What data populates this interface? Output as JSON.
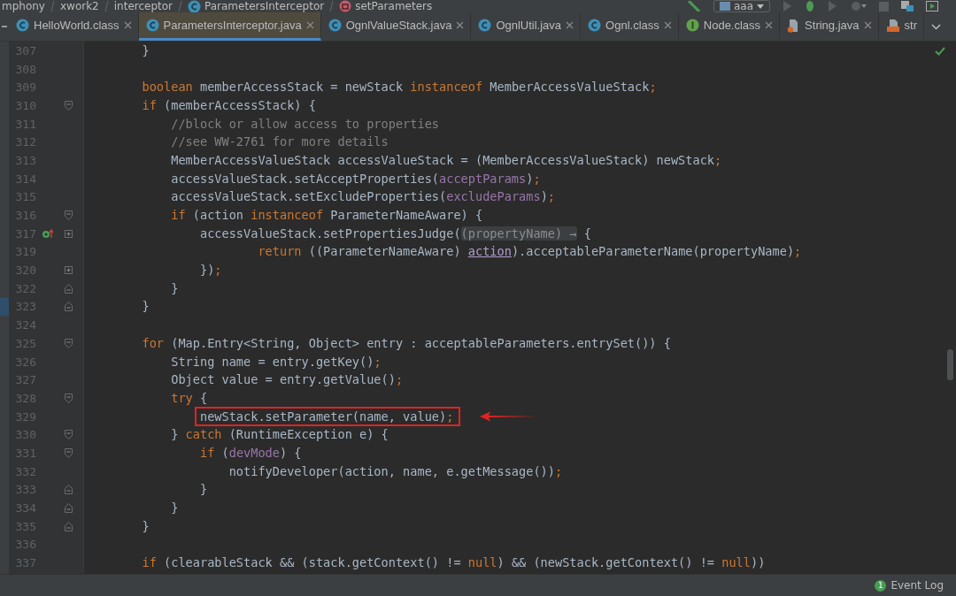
{
  "breadcrumbs": [
    {
      "label": "mphony"
    },
    {
      "label": "xwork2"
    },
    {
      "label": "interceptor"
    },
    {
      "label": "ParametersInterceptor",
      "kind": "class"
    },
    {
      "label": "setParameters",
      "kind": "method"
    }
  ],
  "run_config": {
    "label": "aaa"
  },
  "tabs": [
    {
      "label": "HelloWorld.class",
      "kind": "class",
      "selected": false,
      "closable": true
    },
    {
      "label": "ParametersInterceptor.java",
      "kind": "class",
      "selected": true,
      "closable": true
    },
    {
      "label": "OgnlValueStack.java",
      "kind": "class",
      "selected": false,
      "closable": true
    },
    {
      "label": "OgnlUtil.java",
      "kind": "class",
      "selected": false,
      "closable": true
    },
    {
      "label": "Ognl.class",
      "kind": "class",
      "selected": false,
      "closable": true
    },
    {
      "label": "Node.class",
      "kind": "interface",
      "selected": false,
      "closable": true
    },
    {
      "label": "String.java",
      "kind": "source",
      "selected": false,
      "closable": true
    },
    {
      "label": "str",
      "kind": "html",
      "selected": false,
      "closable": false
    }
  ],
  "editor": {
    "lines": [
      {
        "number": "307",
        "segments": [
          {
            "kind": "plain",
            "text": "        }"
          }
        ]
      },
      {
        "number": "308"
      },
      {
        "number": "309",
        "segments": [
          {
            "kind": "keyword",
            "text": "        boolean"
          },
          {
            "kind": "plain",
            "text": " memberAccessStack = newStack "
          },
          {
            "kind": "keyword",
            "text": "instanceof"
          },
          {
            "kind": "plain",
            "text": " MemberAccessValueStack"
          },
          {
            "kind": "keyword",
            "text": ";"
          }
        ]
      },
      {
        "number": "310",
        "fold": {
          "kind": "start"
        },
        "segments": [
          {
            "kind": "keyword",
            "text": "        if"
          },
          {
            "kind": "plain",
            "text": " (memberAccessStack) {"
          }
        ]
      },
      {
        "number": "311",
        "segments": [
          {
            "kind": "comment",
            "text": "            //block or allow access to properties"
          }
        ]
      },
      {
        "number": "312",
        "segments": [
          {
            "kind": "comment",
            "text": "            //see WW-2761 for more details"
          }
        ]
      },
      {
        "number": "313",
        "segments": [
          {
            "kind": "plain",
            "text": "            MemberAccessValueStack accessValueStack = (MemberAccessValueStack) newStack"
          },
          {
            "kind": "keyword",
            "text": ";"
          }
        ]
      },
      {
        "number": "314",
        "segments": [
          {
            "kind": "plain",
            "text": "            accessValueStack.setAcceptProperties("
          },
          {
            "kind": "field",
            "text": "acceptParams"
          },
          {
            "kind": "plain",
            "text": ")"
          },
          {
            "kind": "keyword",
            "text": ";"
          }
        ]
      },
      {
        "number": "315",
        "segments": [
          {
            "kind": "plain",
            "text": "            accessValueStack.setExcludeProperties("
          },
          {
            "kind": "field",
            "text": "excludeParams"
          },
          {
            "kind": "plain",
            "text": ")"
          },
          {
            "kind": "keyword",
            "text": ";"
          }
        ]
      },
      {
        "number": "316",
        "fold": {
          "kind": "start"
        },
        "segments": [
          {
            "kind": "keyword",
            "text": "            if"
          },
          {
            "kind": "plain",
            "text": " (action "
          },
          {
            "kind": "keyword",
            "text": "instanceof"
          },
          {
            "kind": "plain",
            "text": " ParameterNameAware) {"
          }
        ]
      },
      {
        "number": "317",
        "fold": {
          "kind": "collapsed"
        },
        "gutter_icon": {
          "kind": "override"
        },
        "segments": [
          {
            "kind": "plain",
            "text": "                accessValueStack.setPropertiesJudge("
          },
          {
            "kind": "hint",
            "text": "(propertyName) →"
          },
          {
            "kind": "plain",
            "text": " {"
          }
        ]
      },
      {
        "number": "319",
        "segments": [
          {
            "kind": "keyword",
            "text": "                        return"
          },
          {
            "kind": "plain",
            "text": " ((ParameterNameAware) "
          },
          {
            "kind": "captured",
            "text": "action"
          },
          {
            "kind": "plain",
            "text": ").acceptableParameterName(propertyName)"
          },
          {
            "kind": "keyword",
            "text": ";"
          }
        ]
      },
      {
        "number": "320",
        "fold": {
          "kind": "collapsed"
        },
        "segments": [
          {
            "kind": "plain",
            "text": "                })"
          },
          {
            "kind": "keyword",
            "text": ";"
          }
        ]
      },
      {
        "number": "322",
        "fold": {
          "kind": "end"
        },
        "segments": [
          {
            "kind": "plain",
            "text": "            }"
          }
        ]
      },
      {
        "number": "323",
        "fold": {
          "kind": "end"
        },
        "segments": [
          {
            "kind": "plain",
            "text": "        }"
          }
        ]
      },
      {
        "number": "324"
      },
      {
        "number": "325",
        "fold": {
          "kind": "start"
        },
        "segments": [
          {
            "kind": "keyword",
            "text": "        for"
          },
          {
            "kind": "plain",
            "text": " (Map.Entry<String, Object> entry : acceptableParameters.entrySet()) {"
          }
        ]
      },
      {
        "number": "326",
        "segments": [
          {
            "kind": "plain",
            "text": "            String name = entry.getKey()"
          },
          {
            "kind": "keyword",
            "text": ";"
          }
        ]
      },
      {
        "number": "327",
        "segments": [
          {
            "kind": "plain",
            "text": "            Object value = entry.getValue()"
          },
          {
            "kind": "keyword",
            "text": ";"
          }
        ]
      },
      {
        "number": "328",
        "fold": {
          "kind": "start"
        },
        "segments": [
          {
            "kind": "keyword",
            "text": "            try"
          },
          {
            "kind": "plain",
            "text": " {"
          }
        ]
      },
      {
        "number": "329",
        "boxed": true,
        "segments": [
          {
            "kind": "plain",
            "text": "newStack.setParameter(name, value)"
          },
          {
            "kind": "keyword",
            "text": ";"
          }
        ]
      },
      {
        "number": "330",
        "fold": {
          "kind": "start"
        },
        "segments": [
          {
            "kind": "plain",
            "text": "            } "
          },
          {
            "kind": "keyword",
            "text": "catch"
          },
          {
            "kind": "plain",
            "text": " (RuntimeException e) {"
          }
        ]
      },
      {
        "number": "331",
        "fold": {
          "kind": "start"
        },
        "segments": [
          {
            "kind": "keyword",
            "text": "                if"
          },
          {
            "kind": "plain",
            "text": " ("
          },
          {
            "kind": "field",
            "text": "devMode"
          },
          {
            "kind": "plain",
            "text": ") {"
          }
        ]
      },
      {
        "number": "332",
        "segments": [
          {
            "kind": "plain",
            "text": "                    notifyDeveloper(action, name, e.getMessage())"
          },
          {
            "kind": "keyword",
            "text": ";"
          }
        ]
      },
      {
        "number": "333",
        "fold": {
          "kind": "end"
        },
        "segments": [
          {
            "kind": "plain",
            "text": "                }"
          }
        ]
      },
      {
        "number": "334",
        "fold": {
          "kind": "end"
        },
        "segments": [
          {
            "kind": "plain",
            "text": "            }"
          }
        ]
      },
      {
        "number": "335",
        "fold": {
          "kind": "end"
        },
        "segments": [
          {
            "kind": "plain",
            "text": "        }"
          }
        ]
      },
      {
        "number": "336"
      },
      {
        "number": "337",
        "segments": [
          {
            "kind": "keyword",
            "text": "        if"
          },
          {
            "kind": "plain",
            "text": " (clearableStack && (stack.getContext() != "
          },
          {
            "kind": "keyword",
            "text": "null"
          },
          {
            "kind": "plain",
            "text": ") && (newStack.getContext() != "
          },
          {
            "kind": "keyword",
            "text": "null"
          },
          {
            "kind": "plain",
            "text": "))"
          }
        ]
      }
    ]
  },
  "status_bar": {
    "event_log": {
      "count": "1",
      "label": "Event Log"
    }
  }
}
